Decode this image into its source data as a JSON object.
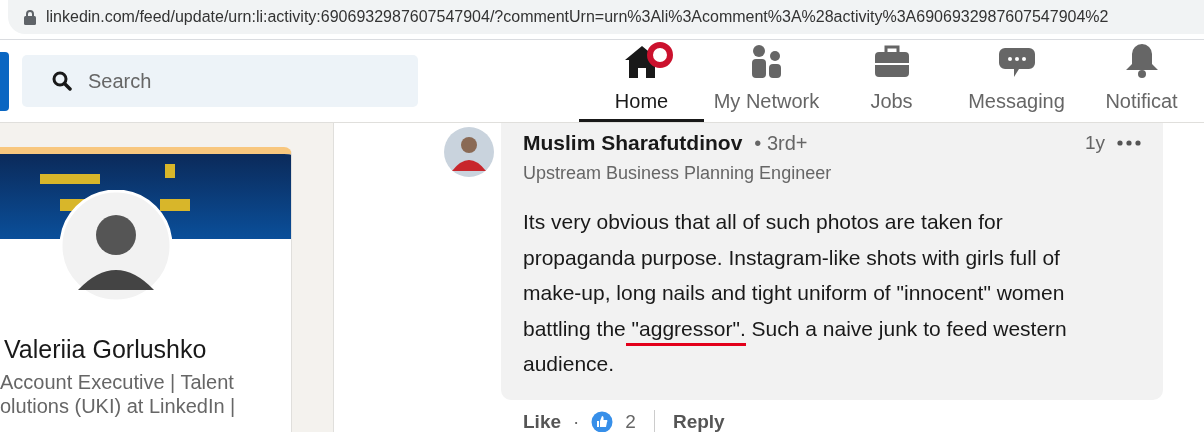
{
  "address_bar": {
    "url": "linkedin.com/feed/update/urn:li:activity:6906932987607547904/?commentUrn=urn%3Ali%3Acomment%3A%28activity%3A6906932987607547904%2"
  },
  "search": {
    "placeholder": "Search"
  },
  "nav": [
    {
      "label": "Home",
      "kind": "home",
      "selected": true,
      "badge": true
    },
    {
      "label": "My Network",
      "kind": "network",
      "selected": false,
      "badge": false
    },
    {
      "label": "Jobs",
      "kind": "jobs",
      "selected": false,
      "badge": false
    },
    {
      "label": "Messaging",
      "kind": "messaging",
      "selected": false,
      "badge": false
    },
    {
      "label": "Notificat",
      "kind": "bell",
      "selected": false,
      "badge": false
    }
  ],
  "profile": {
    "name": "Valeriia Gorlushko",
    "headline": "Account Executive | Talent olutions (UKI) at LinkedIn |"
  },
  "comment": {
    "author": "Muslim Sharafutdinov",
    "degree": "• 3rd+",
    "headline": "Upstream Business Planning Engineer",
    "time": "1y",
    "body": [
      {
        "text": "Its very obvious that all of such photos are taken for propaganda purpose. Instagram-like shots with girls full of make-up, long nails and tight uniform of \"innocent\" women battling the",
        "underlined": false
      },
      {
        "text": " \"aggressor\".",
        "underlined": true
      },
      {
        "text": " Such a naive junk to feed western audience.",
        "underlined": false
      }
    ],
    "like": "Like",
    "separator": "·",
    "reactions": "2",
    "reply": "Reply"
  }
}
